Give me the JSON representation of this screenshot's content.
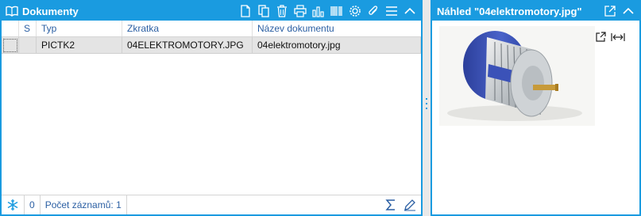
{
  "left_panel": {
    "title": "Dokumenty",
    "toolbar": [
      "new-document-icon",
      "copy-icon",
      "delete-icon",
      "print-icon",
      "chart-icon",
      "barcode-icon",
      "settings-icon",
      "attach-icon",
      "menu-icon",
      "collapse-icon"
    ],
    "grid": {
      "columns": [
        "",
        "S",
        "Typ",
        "Zkratka",
        "Název dokumentu"
      ],
      "rows": [
        {
          "s": "",
          "typ": "PICTK2",
          "zkratka": "04ELEKTROMOTORY.JPG",
          "nazev": "04elektromotory.jpg"
        }
      ]
    },
    "footer": {
      "filter_count": "0",
      "record_count": "Počet záznamů: 1"
    }
  },
  "right_panel": {
    "title": "Náhled \"04elektromotory.jpg\"",
    "image_alt": "electric motor"
  },
  "colors": {
    "accent": "#1a9be0",
    "link": "#2b5fa3",
    "row_selected": "#e4e4e4"
  }
}
